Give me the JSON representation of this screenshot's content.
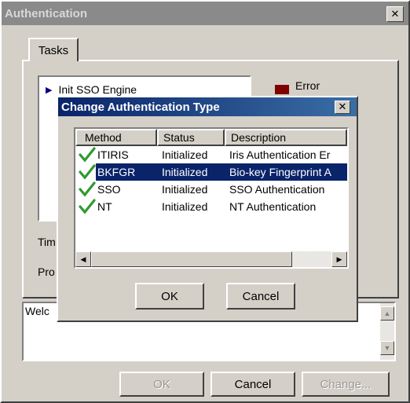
{
  "main_window": {
    "title": "Authentication",
    "tab_label": "Tasks",
    "task_item": "Init SSO Engine",
    "legend_error": "Error",
    "label_time_partial": "Tim",
    "label_pro_partial": "Pro",
    "log_text_partial": "Welc",
    "ok_label": "OK",
    "cancel_label": "Cancel",
    "change_label": "Change..."
  },
  "dialog": {
    "title": "Change Authentication Type",
    "columns": [
      "Method",
      "Status",
      "Description"
    ],
    "rows": [
      {
        "method": "ITIRIS",
        "status": "Initialized",
        "description": "Iris Authentication Er",
        "selected": false
      },
      {
        "method": "BKFGR",
        "status": "Initialized",
        "description": "Bio-key Fingerprint A",
        "selected": true
      },
      {
        "method": "SSO",
        "status": "Initialized",
        "description": "SSO Authentication",
        "selected": false
      },
      {
        "method": "NT",
        "status": "Initialized",
        "description": "NT Authentication",
        "selected": false
      }
    ],
    "ok_label": "OK",
    "cancel_label": "Cancel"
  },
  "colors": {
    "dialog_titlebar": "#0a246a",
    "selection": "#0a246a",
    "error_legend": "#800000",
    "check": "#2e9a2e"
  },
  "icons": [
    "close-icon",
    "play-arrow-icon",
    "check-icon",
    "scroll-left-icon",
    "scroll-right-icon",
    "scroll-up-icon",
    "scroll-down-icon"
  ]
}
